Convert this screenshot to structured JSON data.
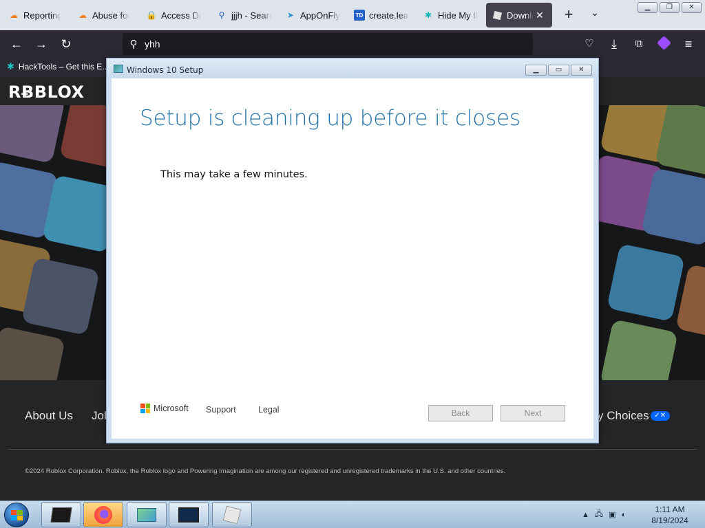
{
  "browser": {
    "tabs": [
      {
        "label": "Reporting",
        "icon": "cloud-icon"
      },
      {
        "label": "Abuse form",
        "icon": "cloud-icon"
      },
      {
        "label": "Access Denied",
        "icon": "lock-icon"
      },
      {
        "label": "jjjh - Search",
        "icon": "search-icon"
      },
      {
        "label": "AppOnFly",
        "icon": "paper-plane-icon"
      },
      {
        "label": "create.lead",
        "icon": "td-icon"
      },
      {
        "label": "Hide My IP",
        "icon": "hide-ip-icon"
      },
      {
        "label": "Download",
        "icon": "roblox-icon",
        "active": true
      }
    ],
    "url": "yhh",
    "bookmark": "HackTools – Get this E..."
  },
  "page": {
    "logo": "RɃBLOX",
    "footer_links": [
      "About Us",
      "Jobs"
    ],
    "privacy_choices": "y Choices",
    "copyright": "©2024 Roblox Corporation. Roblox, the Roblox logo and Powering Imagination are among our registered and unregistered trademarks in the U.S. and other countries."
  },
  "dialog": {
    "title": "Windows 10 Setup",
    "heading": "Setup is cleaning up before it closes",
    "message": "This may take a few minutes.",
    "brand": "Microsoft",
    "support": "Support",
    "legal": "Legal",
    "back": "Back",
    "next": "Next"
  },
  "taskbar": {
    "time": "1:11 AM",
    "date": "8/19/2024"
  }
}
